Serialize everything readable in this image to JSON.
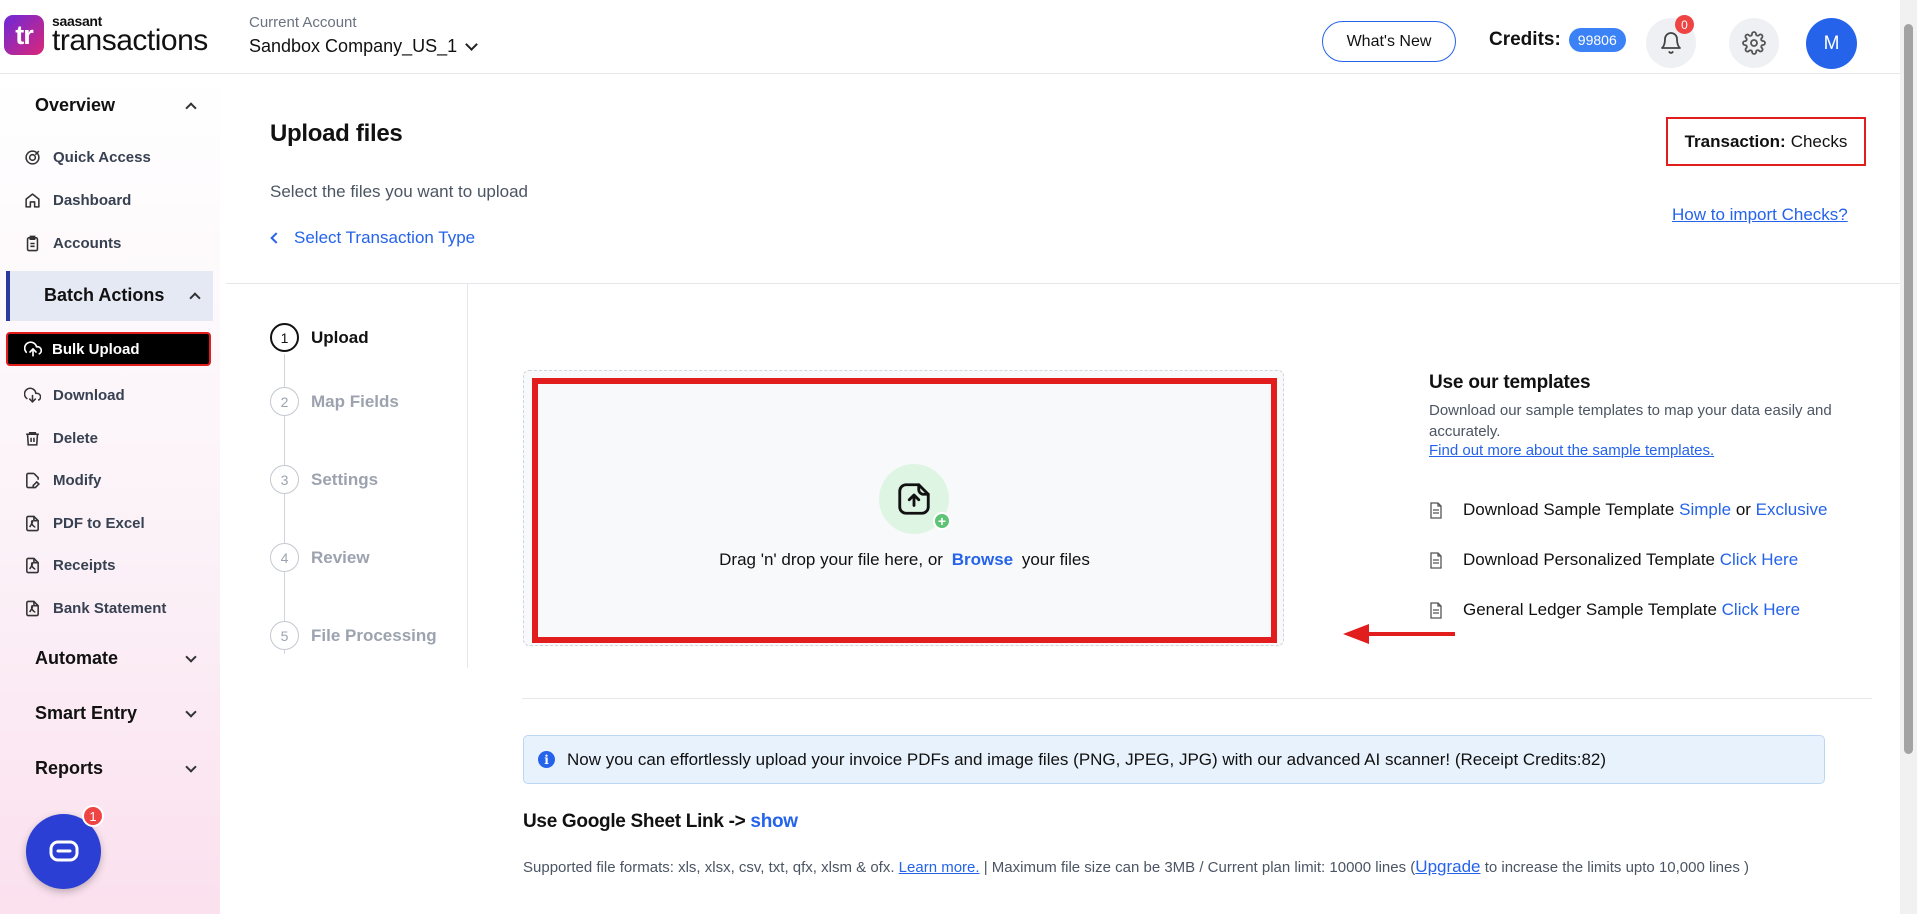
{
  "app": {
    "brand": "saasant",
    "product": "transactions",
    "logo_mark": "tr"
  },
  "header": {
    "account_label": "Current Account",
    "account_name": "Sandbox Company_US_1",
    "whats_new": "What's New",
    "credits_label": "Credits:",
    "credits_value": "99806",
    "notifications_count": "0",
    "avatar_initial": "M"
  },
  "sidebar": {
    "overview": "Overview",
    "overview_items": [
      "Quick Access",
      "Dashboard",
      "Accounts"
    ],
    "batch_actions": "Batch Actions",
    "bulk_upload": "Bulk Upload",
    "batch_items": [
      "Download",
      "Delete",
      "Modify",
      "PDF to Excel",
      "Receipts",
      "Bank Statement"
    ],
    "automate": "Automate",
    "smart_entry": "Smart Entry",
    "reports": "Reports",
    "chat_badge": "1"
  },
  "main": {
    "title": "Upload files",
    "subtitle": "Select the files you want to upload",
    "back_link": "Select Transaction Type",
    "transaction_label": "Transaction:",
    "transaction_value": "Checks",
    "how_to_link": "How to import Checks?",
    "steps": [
      {
        "num": "1",
        "label": "Upload"
      },
      {
        "num": "2",
        "label": "Map Fields"
      },
      {
        "num": "3",
        "label": "Settings"
      },
      {
        "num": "4",
        "label": "Review"
      },
      {
        "num": "5",
        "label": "File Processing"
      }
    ],
    "drop_text_before": "Drag 'n' drop your file here, or",
    "drop_browse": "Browse",
    "drop_text_after": "your files",
    "templates": {
      "title": "Use our templates",
      "description": "Download our sample templates to map your data easily and accurately.",
      "learn_link": "Find out more about the sample templates.",
      "row1_text": "Download Sample Template",
      "row1_simple": "Simple",
      "row1_or": "or",
      "row1_exclusive": "Exclusive",
      "row2_text": "Download Personalized Template",
      "row2_link": "Click Here",
      "row3_text": "General Ledger Sample Template",
      "row3_link": "Click Here"
    },
    "info_text": "Now you can effortlessly upload your invoice PDFs and image files (PNG, JPEG, JPG) with our advanced AI scanner! (Receipt Credits:82)",
    "gsheet_label": "Use Google Sheet Link ->",
    "gsheet_show": "show",
    "formats_text": "Supported file formats: xls, xlsx, csv, txt, qfx, xlsm & ofx.",
    "formats_learn": "Learn more.",
    "formats_limit": "|   Maximum file size can be 3MB / Current plan limit: 10000 lines (",
    "formats_upgrade": "Upgrade",
    "formats_tail": "to increase the limits upto 10,000 lines )"
  },
  "colors": {
    "accent": "#2563eb",
    "highlight": "#e11d1d",
    "nav_active_bg": "#000000"
  }
}
